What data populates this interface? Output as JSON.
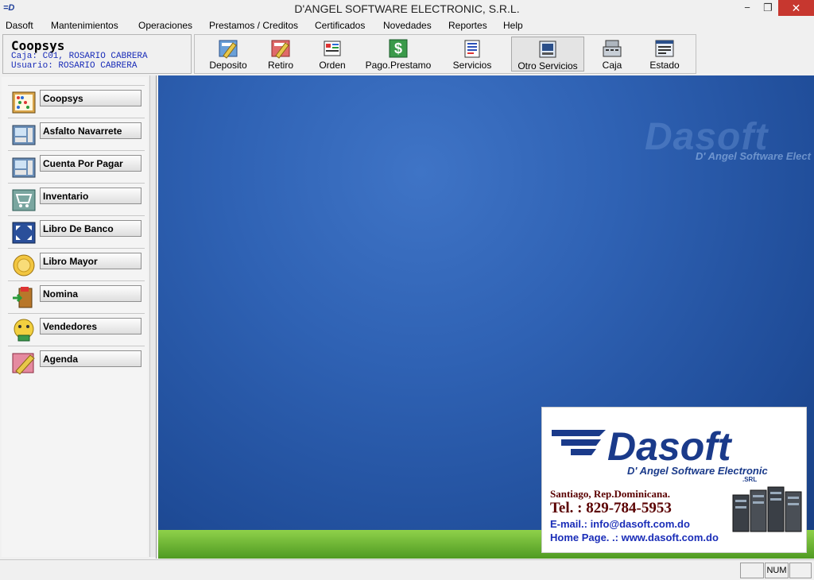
{
  "window": {
    "title": "D'ANGEL SOFTWARE ELECTRONIC, S.R.L.",
    "app_icon_text": "=D",
    "controls": {
      "minimize": "−",
      "maximize": "❐",
      "close": "✕"
    }
  },
  "menu": [
    "Dasoft",
    "Mantenimientos",
    "Operaciones",
    "Prestamos / Creditos",
    "Certificados",
    "Novedades",
    "Reportes",
    "Help"
  ],
  "info": {
    "title": "Coopsys",
    "caja": "Caja: C01, ROSARIO CABRERA",
    "usuario": "Usuario: ROSARIO CABRERA"
  },
  "toolbar": [
    {
      "label": "Deposito",
      "icon": "deposit-icon"
    },
    {
      "label": "Retiro",
      "icon": "withdraw-icon"
    },
    {
      "label": "Orden",
      "icon": "order-icon"
    },
    {
      "label": "Pago.Prestamo",
      "icon": "loan-payment-icon"
    },
    {
      "label": "Servicios",
      "icon": "services-icon"
    },
    {
      "label": "Otro Servicios",
      "icon": "other-services-icon"
    },
    {
      "label": "Caja",
      "icon": "cash-register-icon"
    },
    {
      "label": "Estado",
      "icon": "statement-icon"
    }
  ],
  "sidebar": [
    {
      "label": "Coopsys",
      "icon": "abacus-icon"
    },
    {
      "label": "Asfalto Navarrete",
      "icon": "calculator-icon"
    },
    {
      "label": "Cuenta Por Pagar",
      "icon": "calculator-icon"
    },
    {
      "label": "Inventario",
      "icon": "cart-icon"
    },
    {
      "label": "Libro De Banco",
      "icon": "expand-arrows-icon"
    },
    {
      "label": "Libro Mayor",
      "icon": "coins-icon"
    },
    {
      "label": "Nomina",
      "icon": "exit-door-icon"
    },
    {
      "label": "Vendedores",
      "icon": "smiley-money-icon"
    },
    {
      "label": "Agenda",
      "icon": "pencil-note-icon"
    }
  ],
  "watermark": {
    "logo": "Dasoft",
    "tagline": "D' Angel Software Elect"
  },
  "ad": {
    "logo": "Dasoft",
    "tagline": "D' Angel Software Electronic",
    "srl": ".SRL",
    "city": "Santiago, Rep.Dominicana.",
    "tel": "Tel. :  829-784-5953",
    "email": "E-mail.:   info@dasoft.com.do",
    "home": "Home Page. .:   www.dasoft.com.do"
  },
  "statusbar": {
    "num": "NUM"
  },
  "colors": {
    "desktop_blue": "#2f62b4",
    "info_text": "#1a2db8",
    "brand_dark_blue": "#1a3a8a",
    "close_red": "#c7372f"
  }
}
